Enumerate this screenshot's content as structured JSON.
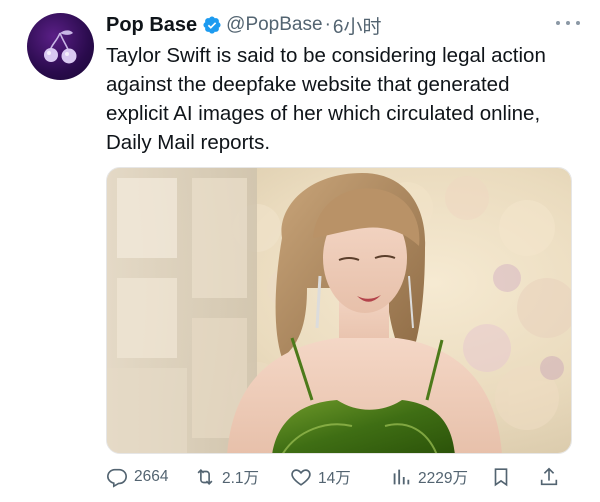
{
  "tweet": {
    "author": {
      "display_name": "Pop Base",
      "handle": "@PopBase",
      "separator": "·",
      "time": "6小时",
      "verified": true,
      "avatar_icon": "cherry-logo-icon"
    },
    "text": "Taylor Swift is said to be considering legal action against the deepfake website that generated explicit AI images of her which circulated online, Daily Mail reports.",
    "media": {
      "kind": "photo"
    },
    "actions": {
      "replies": "2664",
      "reposts": "2.1万",
      "likes": "14万",
      "views": "2229万"
    }
  },
  "colors": {
    "text_primary": "#0f1419",
    "text_secondary": "#536471",
    "verified_blue": "#1d9bf0"
  }
}
